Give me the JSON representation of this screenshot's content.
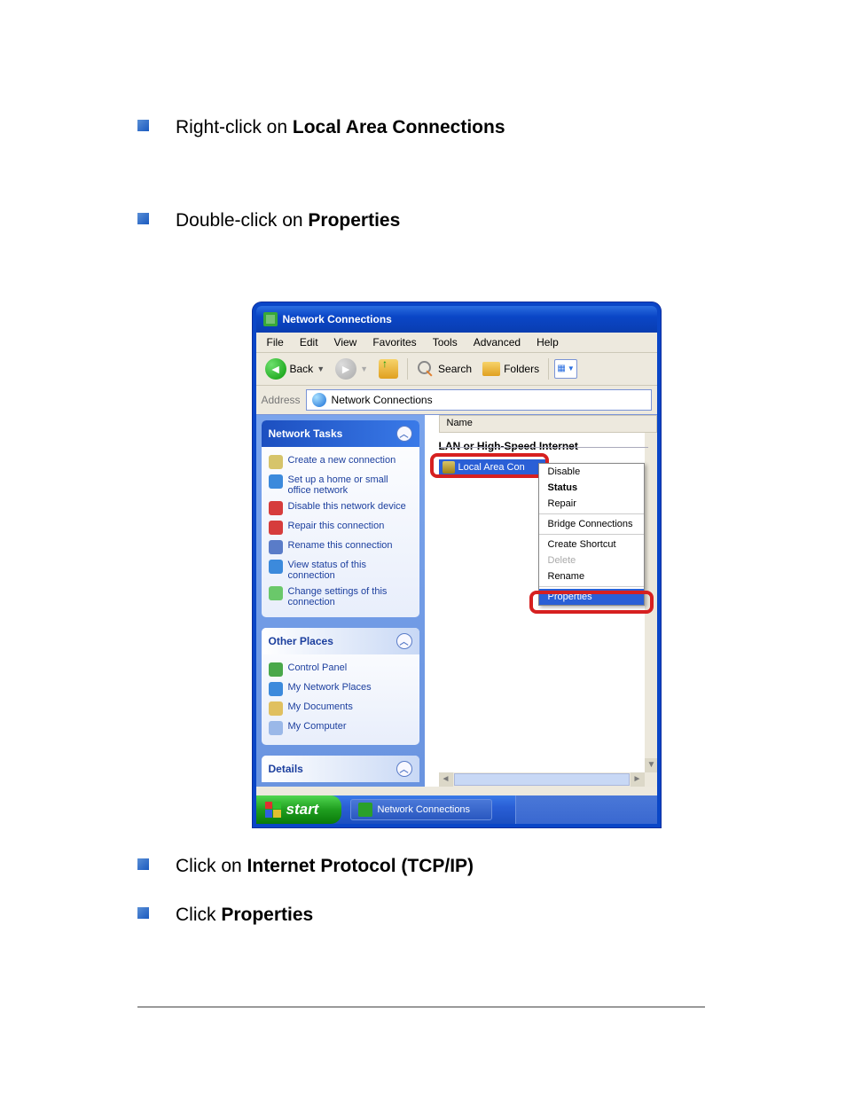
{
  "steps": {
    "s1_a": "Right-click on ",
    "s1_b": "Local Area Connections",
    "s2_a": "Double-click on ",
    "s2_b": "Properties",
    "s3_a": "Click on ",
    "s3_b": "Internet Protocol (TCP/IP)",
    "s4_a": "Click ",
    "s4_b": "Properties"
  },
  "window": {
    "title": "Network Connections",
    "menu": [
      "File",
      "Edit",
      "View",
      "Favorites",
      "Tools",
      "Advanced",
      "Help"
    ],
    "toolbar": {
      "back": "Back",
      "search": "Search",
      "folders": "Folders"
    },
    "address_label": "Address",
    "address_value": "Network Connections",
    "sidebar": {
      "network_tasks_head": "Network Tasks",
      "tasks": [
        "Create a new connection",
        "Set up a home or small office network",
        "Disable this network device",
        "Repair this connection",
        "Rename this connection",
        "View status of this connection",
        "Change settings of this connection"
      ],
      "other_places_head": "Other Places",
      "places": [
        "Control Panel",
        "My Network Places",
        "My Documents",
        "My Computer"
      ],
      "details_head": "Details"
    },
    "pane": {
      "col_name": "Name",
      "section": "LAN or High-Speed Internet",
      "lac": "Local Area Con",
      "ctx": {
        "disable": "Disable",
        "status": "Status",
        "repair": "Repair",
        "bridge": "Bridge Connections",
        "shortcut": "Create Shortcut",
        "delete": "Delete",
        "rename": "Rename",
        "props": "Properties"
      }
    },
    "taskbar": {
      "start": "start",
      "app": "Network Connections"
    }
  }
}
